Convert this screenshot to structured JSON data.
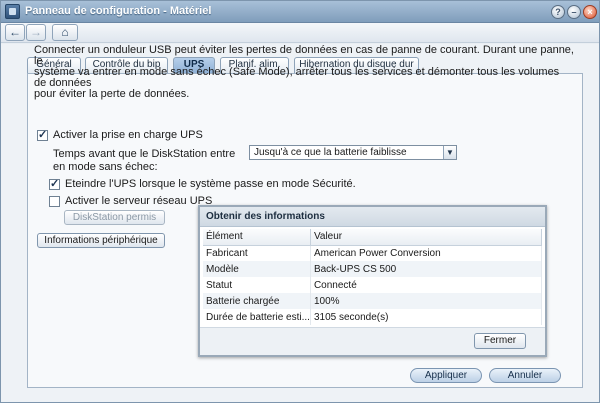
{
  "window": {
    "title": "Panneau de configuration - Matériel"
  },
  "window_controls": {
    "help": "?",
    "minimize": "–",
    "close": "×"
  },
  "toolbar": {
    "back": "←",
    "forward": "→",
    "home": "⌂"
  },
  "tabs": [
    {
      "label": "Général",
      "active": false
    },
    {
      "label": "Contrôle du bip",
      "active": false
    },
    {
      "label": "UPS",
      "active": true
    },
    {
      "label": "Planif. alim.",
      "active": false
    },
    {
      "label": "Hibernation du disque dur",
      "active": false
    }
  ],
  "description": {
    "line1": "Connecter un onduleur USB peut éviter les pertes de données en cas de panne de courant. Durant une panne, le",
    "line2": "système va entrer en mode sans échec (Safe Mode), arrêter tous les services et démonter tous les volumes de données",
    "line3": "pour éviter la perte de données."
  },
  "options": {
    "enable_ups": {
      "label": "Activer la prise en charge UPS",
      "checked": true
    },
    "wait_time": {
      "label": "Temps avant que le DiskStation entre en mode sans échec:",
      "value": "Jusqu'à ce que la batterie faiblisse"
    },
    "shutdown_ups": {
      "label": "Eteindre l'UPS lorsque le système passe en mode Sécurité.",
      "checked": true
    },
    "network_ups": {
      "label": "Activer le serveur réseau UPS",
      "checked": false
    }
  },
  "buttons": {
    "diskstation_permit": "DiskStation permis",
    "device_info": "Informations périphérique",
    "apply": "Appliquer",
    "cancel": "Annuler"
  },
  "info_dialog": {
    "title": "Obtenir des informations",
    "columns": [
      "Élément",
      "Valeur"
    ],
    "rows": [
      {
        "item": "Fabricant",
        "value": "American Power Conversion"
      },
      {
        "item": "Modèle",
        "value": "Back-UPS CS 500"
      },
      {
        "item": "Statut",
        "value": "Connecté"
      },
      {
        "item": "Batterie chargée",
        "value": "100%"
      },
      {
        "item": "Durée de batterie esti...",
        "value": "3105 seconde(s)"
      }
    ],
    "close_label": "Fermer"
  }
}
